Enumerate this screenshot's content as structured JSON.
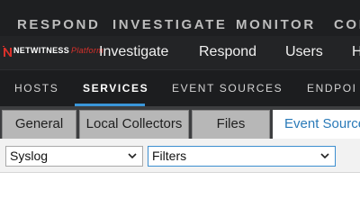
{
  "top_nav": {
    "items": [
      "RESPOND",
      "INVESTIGATE",
      "MONITOR",
      "CON"
    ]
  },
  "logo": {
    "brand": "NETWITNESS",
    "product": "Platform",
    "brand_color": "#d9312b"
  },
  "sub_nav": {
    "items": [
      "Investigate",
      "Respond",
      "Users",
      "H"
    ]
  },
  "third_nav": {
    "items": [
      "HOSTS",
      "SERVICES",
      "EVENT SOURCES",
      "ENDPOI"
    ],
    "active": "SERVICES",
    "accent": "#3a96d9"
  },
  "tabs": {
    "items": [
      "General",
      "Local Collectors",
      "Files",
      "Event Source"
    ],
    "active": "Event Source"
  },
  "toolbar": {
    "type_select_value": "Syslog",
    "filter_select_value": "Filters"
  },
  "icons": {
    "select_arrow": "chevron-down-icon"
  }
}
